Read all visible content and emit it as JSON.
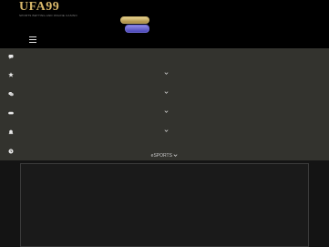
{
  "brand": {
    "name": "UFA99",
    "tagline": "SPORTS BETTING AND ONLINE CASINO"
  },
  "menu": {
    "items": [
      {
        "icon": "chat-icon"
      },
      {
        "icon": "star-icon"
      },
      {
        "icon": "chips-icon"
      },
      {
        "icon": "gamepad-icon"
      },
      {
        "icon": "bell-icon"
      },
      {
        "icon": "clock-icon"
      }
    ],
    "esports_label": "eSPORTS"
  },
  "colors": {
    "accent_gold": "#d9b86a",
    "accent_purple": "#6d69d4",
    "menu_bg": "#33332e"
  }
}
